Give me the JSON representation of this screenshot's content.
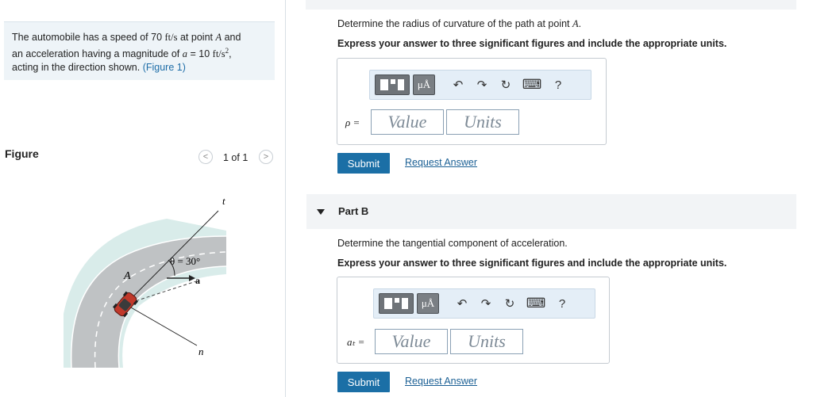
{
  "problem": {
    "t1": "The automobile has a speed of 70",
    "speed_unit": "ft/s",
    "t2": "at point",
    "point": "A",
    "t3": "and",
    "t4": "an acceleration having a magnitude of",
    "a_sym": "a",
    "t5": "= 10",
    "acc_unit": "ft/s",
    "acc_exp": "2",
    "t6": ",",
    "t7": "acting in the direction shown.",
    "link": "(Figure 1)"
  },
  "figure": {
    "label": "Figure",
    "pager": "1 of 1",
    "prev": "<",
    "next": ">",
    "labels": {
      "t": "t",
      "n": "n",
      "A": "A",
      "theta": "θ = 30°",
      "a": "a"
    }
  },
  "partA": {
    "question": "Determine the radius of curvature of the path at point",
    "question_point": "A",
    "question_end": ".",
    "instruction": "Express your answer to three significant figures and include the appropriate units.",
    "var_label": "ρ =",
    "value_placeholder": "Value",
    "units_placeholder": "Units",
    "submit": "Submit",
    "request": "Request Answer"
  },
  "partB": {
    "title": "Part B",
    "question": "Determine the tangential component of acceleration.",
    "instruction": "Express your answer to three significant figures and include the appropriate units.",
    "var_label": "aₜ =",
    "value_placeholder": "Value",
    "units_placeholder": "Units",
    "submit": "Submit",
    "request": "Request Answer"
  },
  "toolbar": {
    "mu": "μÅ",
    "undo": "↶",
    "redo": "↷",
    "reset": "↻",
    "keyboard": "⌨",
    "help": "?"
  },
  "colors": {
    "accent": "#1b6fa6",
    "link": "#1f6ea8",
    "panel": "#eef4f8"
  }
}
